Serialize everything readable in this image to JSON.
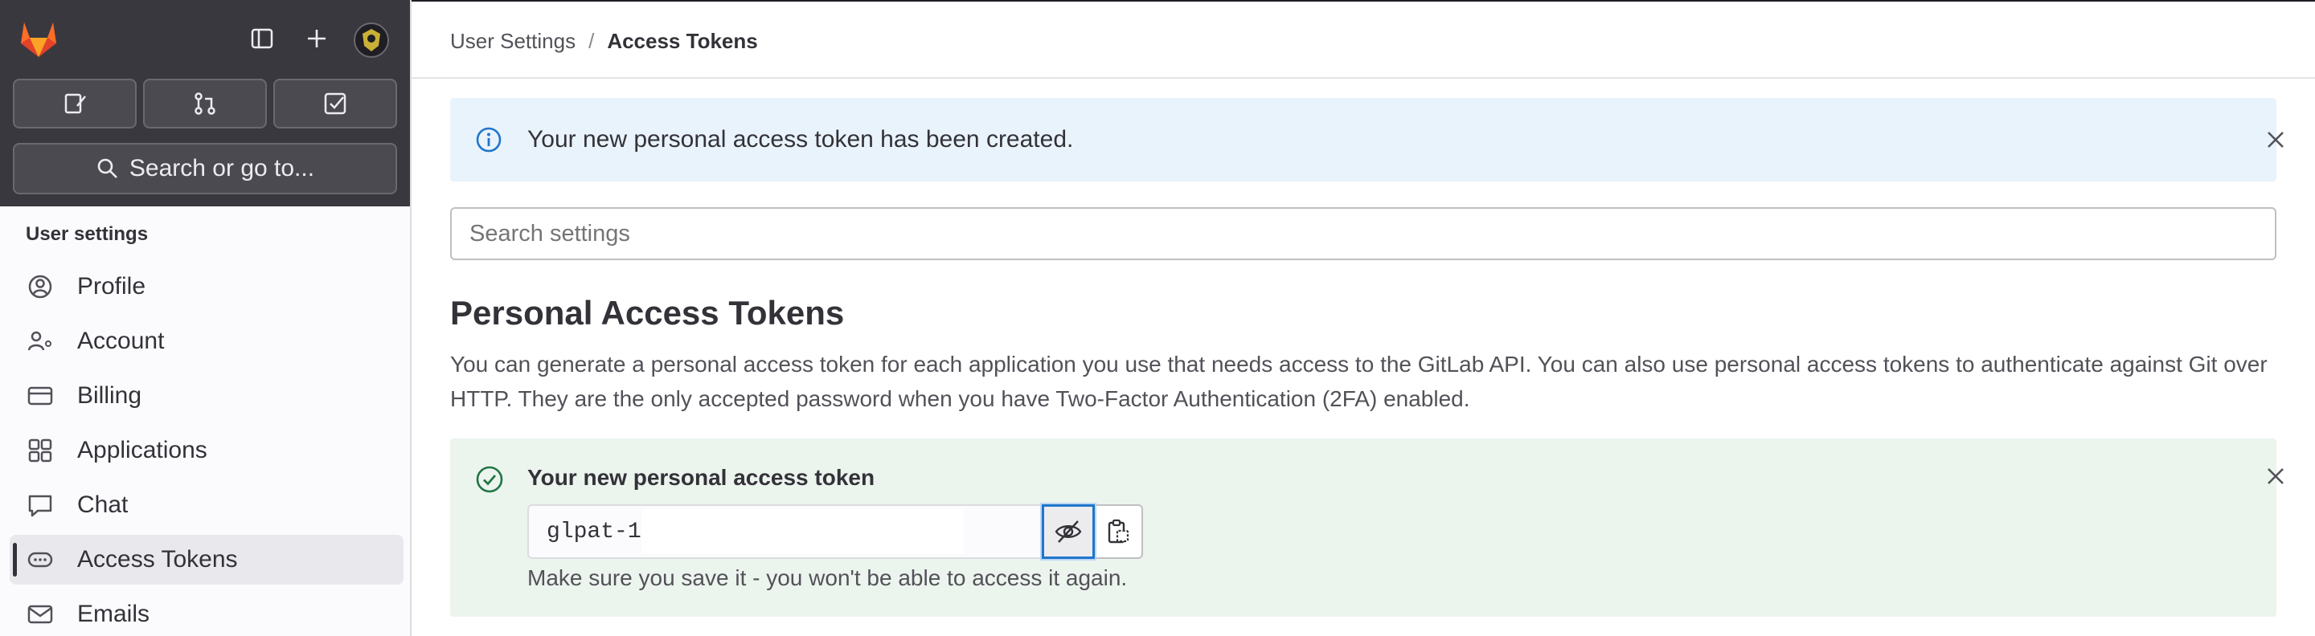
{
  "sidebar": {
    "search_label": "Search or go to...",
    "section_heading": "User settings",
    "items": [
      {
        "label": "Profile",
        "icon": "profile-icon"
      },
      {
        "label": "Account",
        "icon": "account-icon"
      },
      {
        "label": "Billing",
        "icon": "billing-icon"
      },
      {
        "label": "Applications",
        "icon": "applications-icon"
      },
      {
        "label": "Chat",
        "icon": "chat-icon"
      },
      {
        "label": "Access Tokens",
        "icon": "token-icon",
        "active": true
      },
      {
        "label": "Emails",
        "icon": "mail-icon"
      }
    ]
  },
  "breadcrumb": {
    "parent": "User Settings",
    "separator": "/",
    "current": "Access Tokens"
  },
  "info_alert": {
    "message": "Your new personal access token has been created."
  },
  "search_settings": {
    "placeholder": "Search settings"
  },
  "page": {
    "title": "Personal Access Tokens",
    "description": "You can generate a personal access token for each application you use that needs access to the GitLab API. You can also use personal access tokens to authenticate against Git over HTTP. They are the only accepted password when you have Two-Factor Authentication (2FA) enabled."
  },
  "token_alert": {
    "title": "Your new personal access token",
    "token_value": "glpat-1",
    "helper": "Make sure you save it - you won't be able to access it again."
  },
  "colors": {
    "sidebar_top": "#3a383f",
    "info_bg": "#e9f3fc",
    "success_bg": "#ecf4ee",
    "focus_ring": "#1f75cb",
    "brand_orange": "#e24329"
  }
}
